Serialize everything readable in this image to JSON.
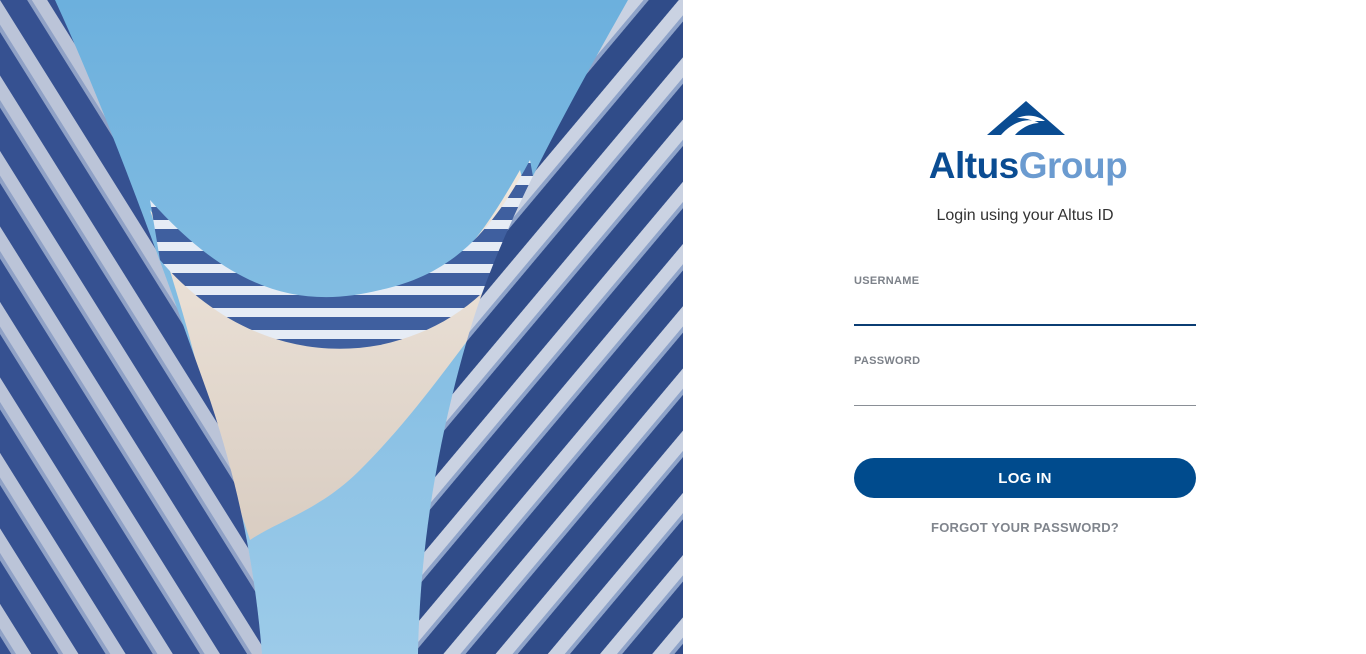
{
  "hero": {
    "image": "curved-building-facade-photo"
  },
  "logo": {
    "icon": "altus-triangle-logo-icon",
    "word1": "Altus",
    "word2": "Group"
  },
  "login": {
    "subtitle": "Login using your Altus ID",
    "username_label": "USERNAME",
    "username_value": "",
    "password_label": "PASSWORD",
    "password_value": "",
    "submit_label": "LOG IN",
    "forgot_label": "FORGOT YOUR PASSWORD?"
  },
  "colors": {
    "brand_dark": "#004b8d",
    "brand_light": "#6b9bd0",
    "label_gray": "#7c8189"
  }
}
